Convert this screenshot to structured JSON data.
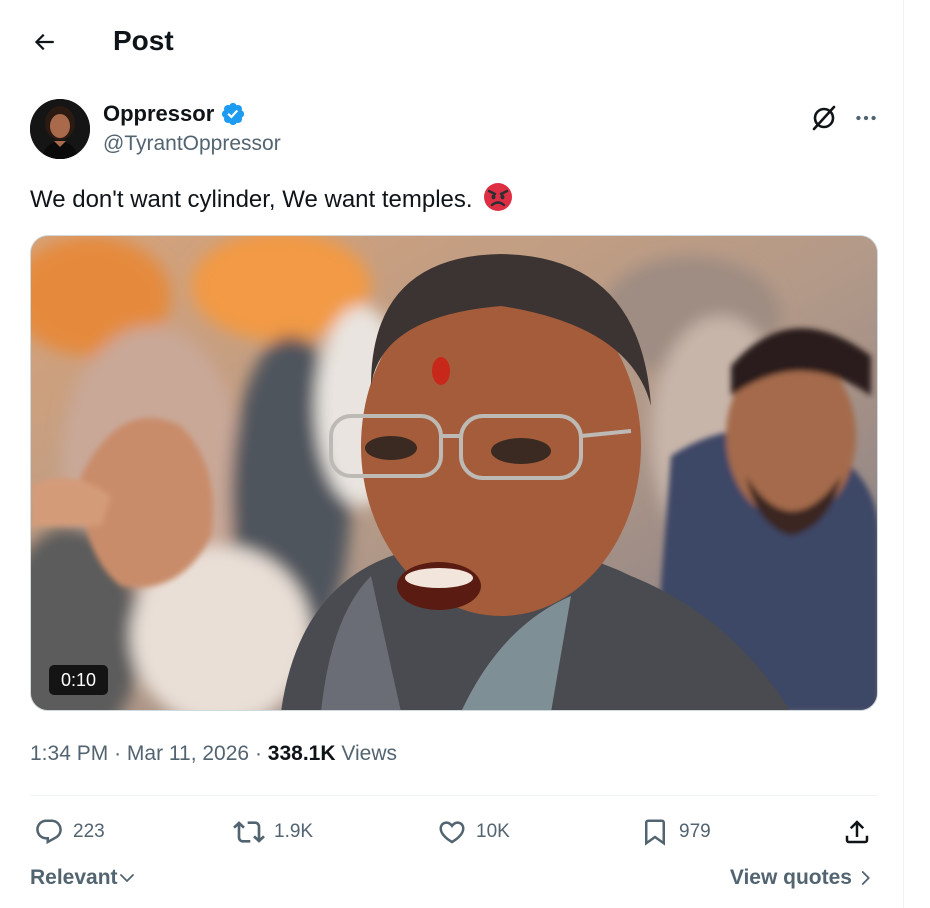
{
  "header": {
    "back_icon": "arrow-left-icon",
    "title": "Post"
  },
  "author": {
    "display_name": "Oppressor",
    "handle": "@TyrantOppressor",
    "verified_icon": "verified-badge-icon",
    "verified_color": "#1d9bf0"
  },
  "top_actions": {
    "grok_icon": "grok-icon",
    "more_icon": "more-icon"
  },
  "tweet": {
    "text": "We don't want cylinder, We want temples.",
    "emoji_icon": "angry-face-emoji"
  },
  "media": {
    "type": "video",
    "duration": "0:10"
  },
  "meta": {
    "time": "1:34 PM",
    "separator": "·",
    "date": "Mar 11, 2026",
    "views_count": "338.1K",
    "views_label": "Views"
  },
  "actions": {
    "replies": "223",
    "reposts": "1.9K",
    "likes": "10K",
    "bookmarks": "979"
  },
  "footer": {
    "sort_label": "Relevant",
    "view_quotes_label": "View quotes"
  },
  "colors": {
    "text_primary": "#0f1419",
    "text_secondary": "#536471",
    "accent": "#1d9bf0",
    "divider": "#eff3f4"
  }
}
